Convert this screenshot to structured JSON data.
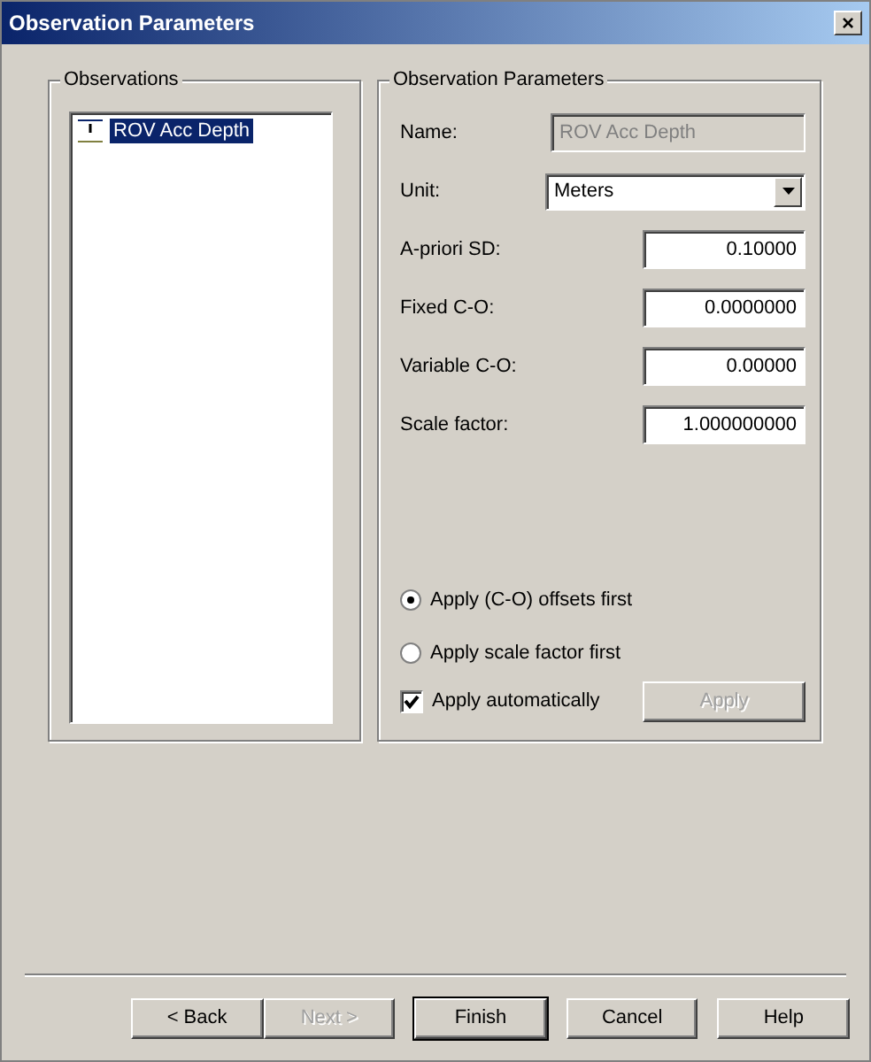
{
  "window": {
    "title": "Observation Parameters",
    "close": "×"
  },
  "observations": {
    "label": "Observations",
    "items": [
      {
        "label": "ROV Acc Depth",
        "selected": true
      }
    ]
  },
  "parameters": {
    "label": "Observation Parameters",
    "fields": [
      {
        "kind": "readonly",
        "label": "Name:",
        "value": "ROV Acc Depth"
      },
      {
        "kind": "select",
        "label": "Unit:",
        "value": "Meters"
      },
      {
        "kind": "number",
        "label": "A-priori SD:",
        "value": "0.10000"
      },
      {
        "kind": "number",
        "label": "Fixed C-O:",
        "value": "0.0000000"
      },
      {
        "kind": "number",
        "label": "Variable C-O:",
        "value": "0.00000"
      },
      {
        "kind": "number",
        "label": "Scale factor:",
        "value": "1.000000000"
      }
    ],
    "order_options": [
      {
        "label": "Apply (C-O) offsets first",
        "selected": true
      },
      {
        "label": "Apply scale factor first",
        "selected": false
      }
    ],
    "auto_apply": {
      "label": "Apply automatically",
      "checked": true
    },
    "apply_button": {
      "label": "Apply",
      "disabled": true
    }
  },
  "buttons": [
    {
      "label": "< Back",
      "disabled": false,
      "default": false
    },
    {
      "label": "Next >",
      "disabled": true,
      "default": false
    },
    {
      "label": "Finish",
      "disabled": false,
      "default": true
    },
    {
      "label": "Cancel",
      "disabled": false,
      "default": false
    },
    {
      "label": "Help",
      "disabled": false,
      "default": false
    }
  ]
}
